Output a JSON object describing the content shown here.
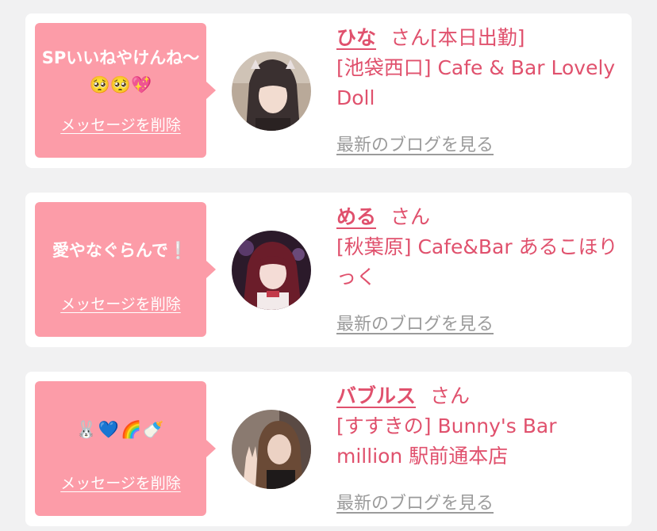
{
  "colors": {
    "background": "#f1f1f2",
    "card": "#ffffff",
    "bubble": "#fc9ca8",
    "accent": "#e0516d",
    "muted": "#9b9b9b"
  },
  "cards": [
    {
      "message": "SPいいねやけんね〜🥺🥺💖",
      "delete_label": "メッセージを削除",
      "name": "ひな",
      "honorific": "さん[本日出勤]",
      "shop": "[池袋西口] Cafe & Bar Lovely Doll",
      "blog_label": "最新のブログを見る"
    },
    {
      "message": "愛やなぐらんで❕",
      "delete_label": "メッセージを削除",
      "name": "める",
      "honorific": "さん",
      "shop": "[秋葉原] Cafe&Bar あるこほりっく",
      "blog_label": "最新のブログを見る"
    },
    {
      "message": "🐰💙🌈🍼",
      "delete_label": "メッセージを削除",
      "name": "バブルス",
      "honorific": "さん",
      "shop": "[すすきの] Bunny's Bar million 駅前通本店",
      "blog_label": "最新のブログを見る"
    }
  ]
}
